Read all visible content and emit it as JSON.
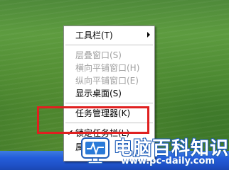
{
  "context_menu": {
    "items": [
      {
        "label": "工具栏(T)",
        "enabled": true,
        "submenu": true
      },
      {
        "label": "层叠窗口(S)",
        "enabled": false
      },
      {
        "label": "横向平铺窗口(H)",
        "enabled": false
      },
      {
        "label": "纵向平铺窗口(E)",
        "enabled": false
      },
      {
        "label": "显示桌面(S)",
        "enabled": true
      },
      {
        "label": "任务管理器(K)",
        "enabled": true
      },
      {
        "label": "锁定任务栏(L)",
        "enabled": true,
        "checked": true
      },
      {
        "label": "属",
        "enabled": true
      }
    ],
    "check_mark": "✔"
  },
  "watermark": {
    "title": "电脑百科知识",
    "url": "www.pc-daily.com"
  },
  "colors": {
    "highlight": "#e02020",
    "taskbar": "#245edb",
    "watermark_blue": "#1f5db8"
  }
}
